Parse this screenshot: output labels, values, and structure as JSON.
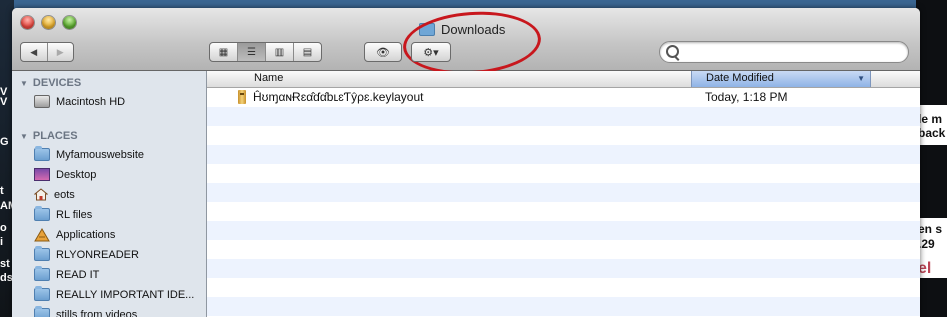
{
  "window": {
    "title": "Downloads"
  },
  "toolbar": {
    "back_label": "◀",
    "forward_label": "▶",
    "view_buttons": [
      {
        "name": "icon-view",
        "glyph": "▦"
      },
      {
        "name": "list-view",
        "glyph": "☰"
      },
      {
        "name": "column-view",
        "glyph": "▥"
      },
      {
        "name": "cover-flow-view",
        "glyph": "▤"
      }
    ],
    "quicklook_glyph": "👁",
    "action_glyph": "⚙▾",
    "search_placeholder": ""
  },
  "sidebar": {
    "devices_header": "DEVICES",
    "places_header": "PLACES",
    "devices": [
      {
        "label": "Macintosh HD",
        "icon": "hard-drive-icon"
      }
    ],
    "places": [
      {
        "label": "Myfamouswebsite",
        "icon": "folder-icon"
      },
      {
        "label": "Desktop",
        "icon": "desktop-icon"
      },
      {
        "label": "eots",
        "icon": "home-icon"
      },
      {
        "label": "RL files",
        "icon": "folder-icon"
      },
      {
        "label": "Applications",
        "icon": "applications-icon"
      },
      {
        "label": "RLYONREADER",
        "icon": "folder-icon"
      },
      {
        "label": "READ IT",
        "icon": "folder-icon"
      },
      {
        "label": "REALLY IMPORTANT IDE...",
        "icon": "folder-icon"
      },
      {
        "label": "stills from videos",
        "icon": "folder-icon"
      }
    ]
  },
  "file_list": {
    "columns": {
      "name": "Name",
      "date_modified": "Date Modified"
    },
    "rows": [
      {
        "name": "ĤʊɱαɴɌɛα̂ɗα̂bʟɛƬŷρɛ.keylayout",
        "date": "Today, 1:18 PM",
        "icon": "keylayout-file-icon"
      }
    ]
  },
  "background": {
    "left_texts": [
      "V",
      "V",
      "G",
      "t",
      "AM",
      "o",
      "i",
      "st",
      "ds"
    ],
    "right_texts": [
      "le m",
      "back",
      "en s",
      ".29",
      "el"
    ]
  },
  "colors": {
    "annotation_circle": "#c8171d",
    "selected_column": "#8fb3e6",
    "sidebar_bg": "#dfe5ec"
  }
}
